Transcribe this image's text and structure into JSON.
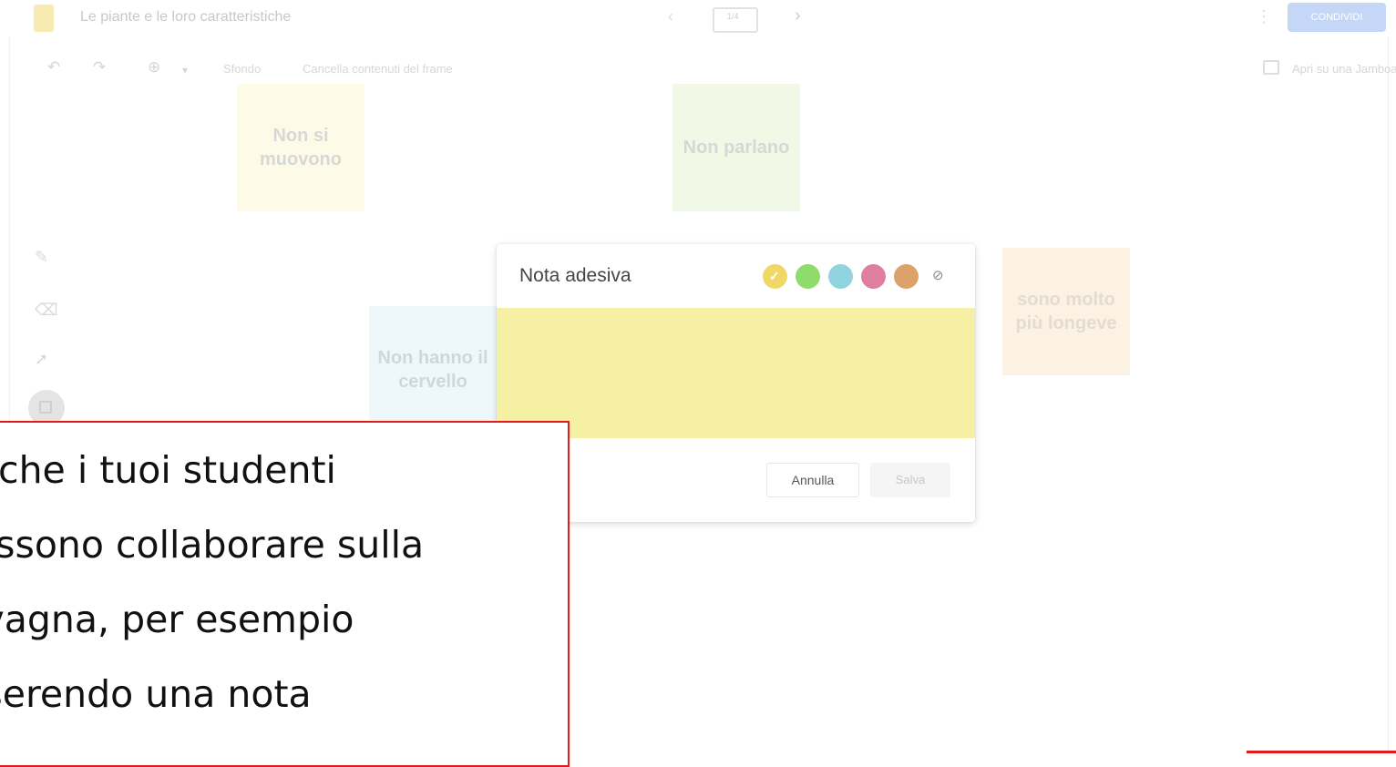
{
  "app": {
    "doc_title": "Le piante e le loro caratteristiche",
    "frame_counter": "1/4",
    "share_label": "CONDIVIDI"
  },
  "toolbar": {
    "background_label": "Sfondo",
    "clear_frame_label": "Cancella contenuti del frame",
    "open_label": "Apri su una Jamboard"
  },
  "stickies": [
    {
      "text": "Non si muovono",
      "color": "#fdfbe8"
    },
    {
      "text": "Non parlano",
      "color": "#f1f9e6"
    },
    {
      "text": "Non hanno il cervello",
      "color": "#eef8fb"
    },
    {
      "text": "sono molto più longeve",
      "color": "#fcf2e3"
    }
  ],
  "dialog": {
    "title": "Nota adesiva",
    "colors": [
      "#f0d867",
      "#8fdc6b",
      "#8fd4e0",
      "#de7fa0",
      "#dca26a"
    ],
    "selected_color_index": 0,
    "cancel_label": "Annulla",
    "save_label": "Salva",
    "note_background": "#f6f0a4"
  },
  "caption": {
    "lines": [
      "Anche i tuoi studenti",
      "possono collaborare sulla",
      "lavagna, per esempio",
      "inserendo una nota"
    ]
  }
}
